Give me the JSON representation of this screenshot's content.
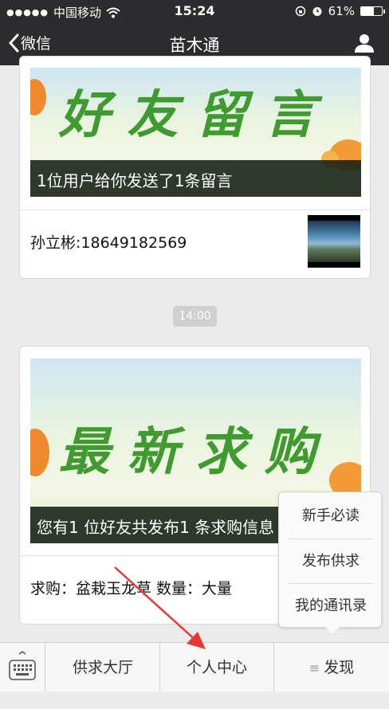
{
  "status_bar": {
    "carrier": "中国移动",
    "time": "15:24",
    "battery": "61%",
    "battery_level": 0.61
  },
  "nav": {
    "back_label": "微信",
    "title": "苗木通"
  },
  "cards": [
    {
      "banner_title": "好友留言",
      "banner_caption": "1位用户给你发送了1条留言",
      "row_text": "孙立彬:18649182569"
    },
    {
      "banner_title": "最新求购",
      "banner_caption": "您有1 位好友共发布1 条求购信息",
      "row_text": "求购：盆栽玉龙草 数量：大量"
    }
  ],
  "time_badge": "14:00",
  "popup_menu": [
    "新手必读",
    "发布供求",
    "我的通讯录"
  ],
  "bottom_bar": {
    "tabs": [
      "供求大厅",
      "个人中心",
      "发现"
    ]
  },
  "colors": {
    "nav_bg": "#2c2c2e",
    "banner_text": "#3f9a2f",
    "annotation_arrow": "#e53935"
  }
}
